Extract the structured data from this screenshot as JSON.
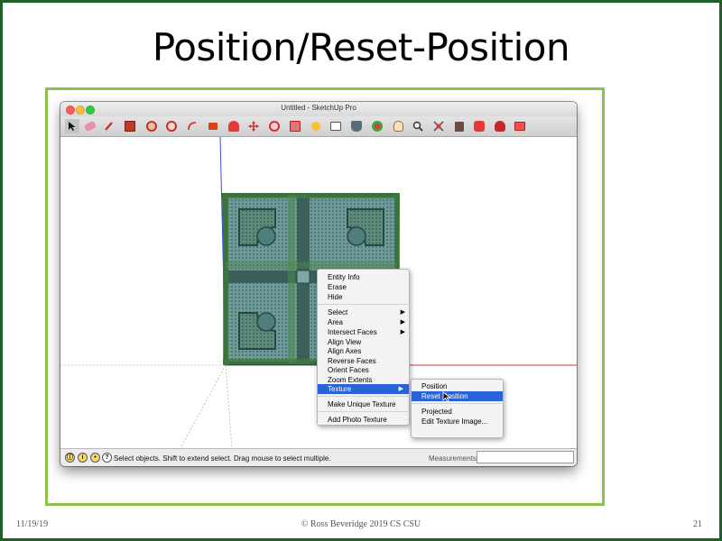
{
  "slide": {
    "title": "Position/Reset-Position",
    "footer_date": "11/19/19",
    "footer_credit": "© Ross Beveridge  2019 CS CSU",
    "footer_page": "21"
  },
  "window": {
    "title": "Untitled - SketchUp Pro"
  },
  "toolbar": {
    "tools": [
      "select-icon",
      "eraser-icon",
      "pencil-icon",
      "rectangle-icon",
      "circle-icon",
      "polygon-icon",
      "arc-icon",
      "push-pull-icon",
      "follow-me-icon",
      "move-icon",
      "rotate-icon",
      "scale-icon",
      "tape-measure-icon",
      "text-icon",
      "paint-bucket-icon",
      "orbit-icon",
      "pan-icon",
      "zoom-icon",
      "zoom-extents-icon",
      "components-icon",
      "warehouse-icon",
      "extension-warehouse-icon",
      "send-to-layout-icon"
    ]
  },
  "context_menu": {
    "items": [
      "Entity Info",
      "Erase",
      "Hide"
    ],
    "group2": [
      "Select",
      "Area",
      "Intersect Faces",
      "Align View",
      "Align Axes",
      "Reverse Faces",
      "Orient Faces",
      "Zoom Extents",
      "Texture"
    ],
    "group3": [
      "Make Unique Texture"
    ],
    "group4": [
      "Add Photo Texture"
    ]
  },
  "texture_submenu": {
    "position": "Position",
    "reset_position": "Reset Position",
    "projected": "Projected",
    "edit_texture": "Edit Texture Image..."
  },
  "status": {
    "text": "Select objects. Shift to extend select. Drag mouse to select multiple.",
    "measurements_label": "Measurements",
    "measurements_value": ""
  },
  "colors": {
    "slide_border": "#1f5f2a",
    "screenshot_border": "#8bc34a",
    "menu_highlight": "#2a62d9",
    "texture_teal": "#4f7f7c",
    "texture_green": "#3f7a3a"
  }
}
